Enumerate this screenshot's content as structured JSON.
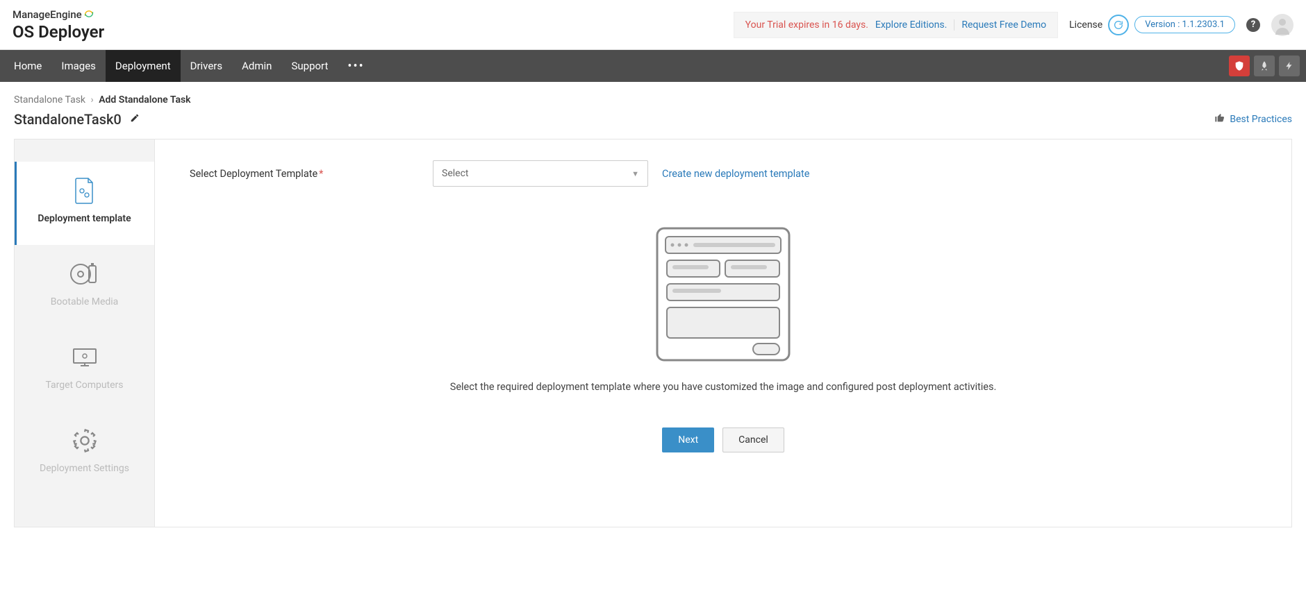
{
  "header": {
    "logo_top": "ManageEngine",
    "logo_bottom": "OS Deployer",
    "trial_text": "Your Trial expires in 16 days.",
    "explore_link": "Explore Editions.",
    "demo_link": "Request Free Demo",
    "license_label": "License",
    "version_label": "Version : 1.1.2303.1"
  },
  "nav": {
    "items": [
      "Home",
      "Images",
      "Deployment",
      "Drivers",
      "Admin",
      "Support"
    ],
    "active_index": 2
  },
  "breadcrumb": {
    "parent": "Standalone Task",
    "current": "Add Standalone Task"
  },
  "page": {
    "title": "StandaloneTask0",
    "best_practices": "Best Practices"
  },
  "steps": [
    {
      "label": "Deployment template",
      "active": true
    },
    {
      "label": "Bootable Media",
      "active": false
    },
    {
      "label": "Target Computers",
      "active": false
    },
    {
      "label": "Deployment Settings",
      "active": false
    }
  ],
  "form": {
    "label": "Select Deployment Template",
    "select_placeholder": "Select",
    "create_link": "Create new deployment template",
    "description": "Select the required deployment template where you have customized the image and configured post deployment activities.",
    "next_btn": "Next",
    "cancel_btn": "Cancel"
  },
  "icons": {
    "shield": "shield-icon",
    "rocket": "rocket-icon",
    "bolt": "bolt-icon"
  }
}
